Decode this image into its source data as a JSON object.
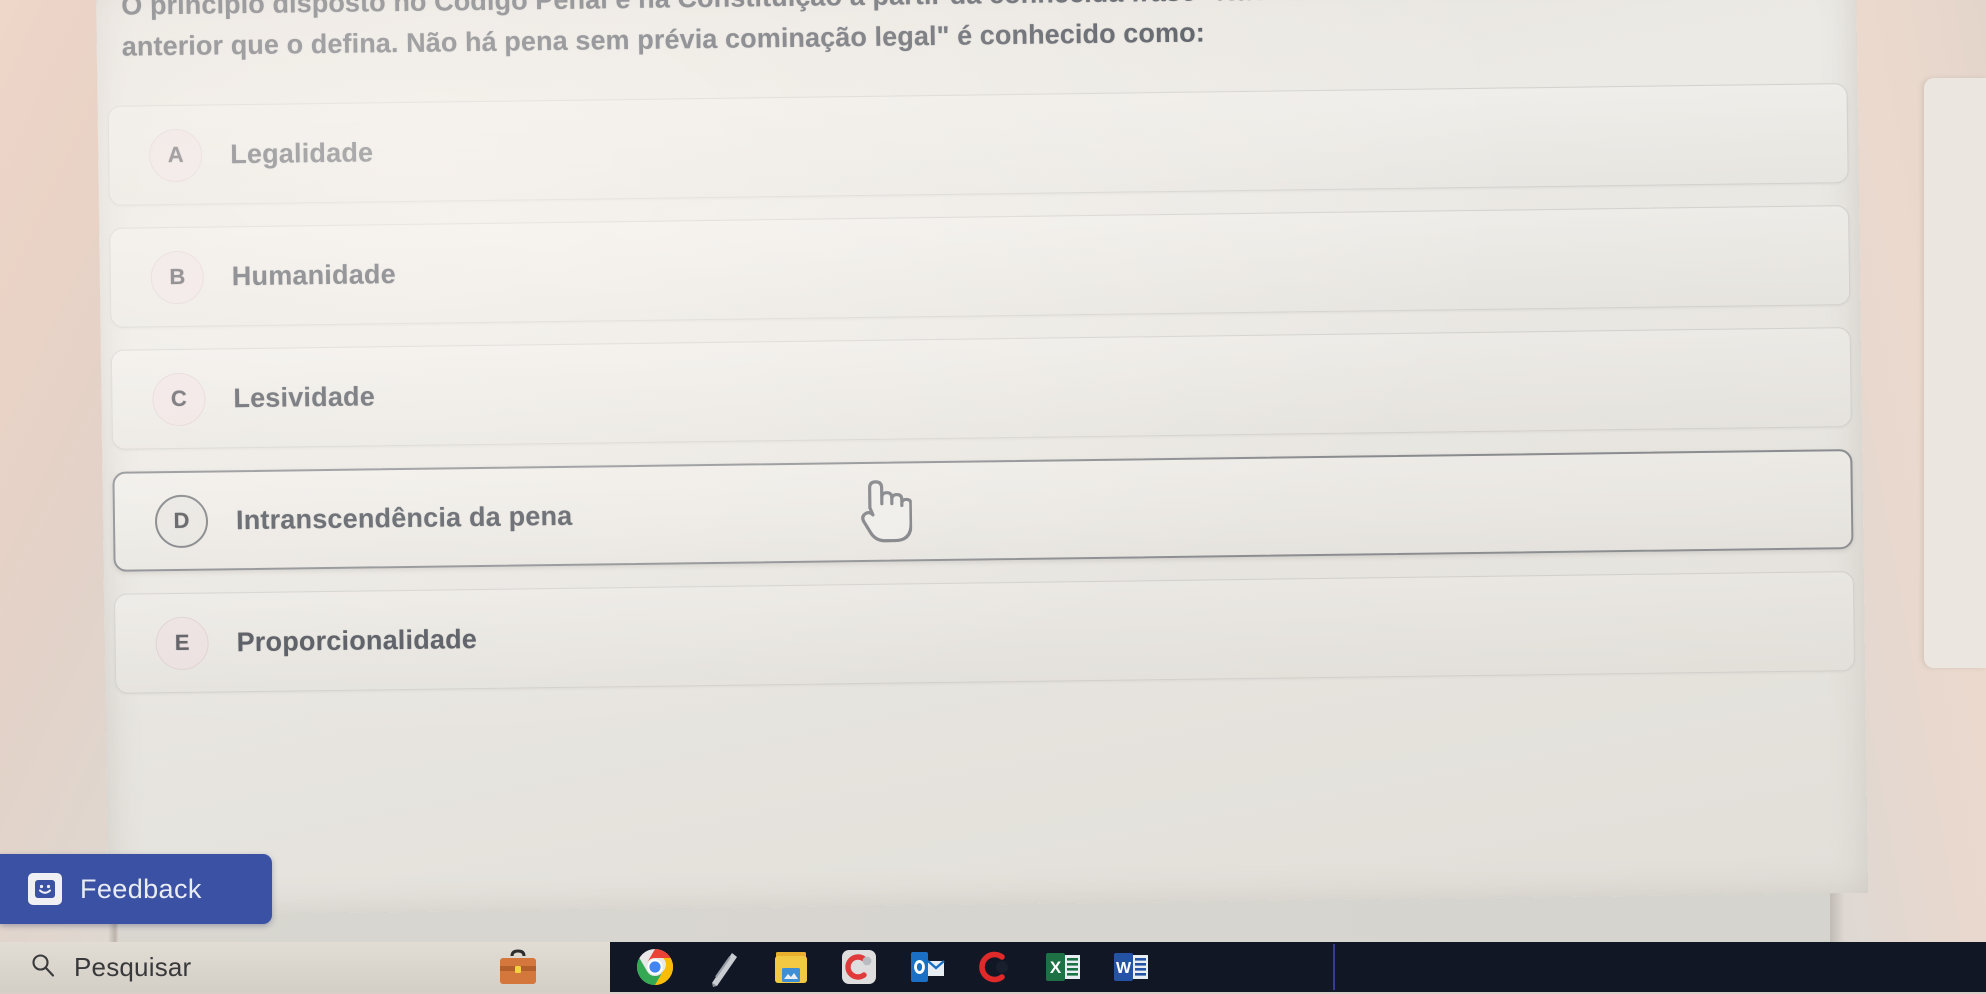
{
  "question": {
    "text": "O princípio disposto no Código Penal e na Constituição a partir da conhecida frase \"Não há crime sem lei anterior que o defina. Não há pena sem prévia cominação legal\" é conhecido como:"
  },
  "options": [
    {
      "letter": "A",
      "label": "Legalidade",
      "state": "normal"
    },
    {
      "letter": "B",
      "label": "Humanidade",
      "state": "normal"
    },
    {
      "letter": "C",
      "label": "Lesividade",
      "state": "normal"
    },
    {
      "letter": "D",
      "label": "Intranscendência da pena",
      "state": "hover"
    },
    {
      "letter": "E",
      "label": "Proporcionalidade",
      "state": "normal"
    }
  ],
  "feedback": {
    "label": "Feedback",
    "icon": "smiley-face-icon",
    "color": "#3b52a4"
  },
  "taskbar": {
    "search_label": "Pesquisar",
    "search_icon": "search-icon",
    "icons": [
      "briefcase-icon",
      "chrome-icon",
      "grey-app-icon",
      "yellow-folder-icon",
      "canva-icon",
      "outlook-icon",
      "red-circle-app-icon",
      "excel-icon",
      "word-icon"
    ]
  },
  "cursor": {
    "type": "pointing-hand-cursor"
  },
  "colors": {
    "page_background": "#eceae5",
    "card_border": "#d3d2cf",
    "card_border_hover": "#7f8287",
    "badge_background": "#efe4e4",
    "text": "#3e444d",
    "feedback_blue": "#3b52a4",
    "taskbar_dark": "#121726"
  }
}
